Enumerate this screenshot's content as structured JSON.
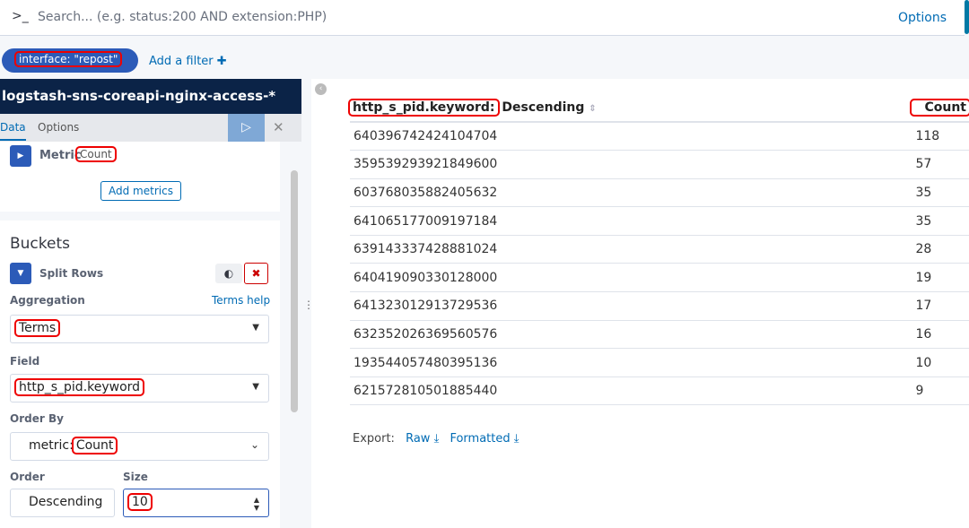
{
  "search": {
    "prompt": ">_",
    "placeholder": "Search... (e.g. status:200 AND extension:PHP)",
    "options": "Options"
  },
  "filters": {
    "pill": "interface: \"repost\"",
    "add": "Add a filter ✚"
  },
  "sidebar": {
    "index": "logstash-sns-coreapi-nginx-access-*",
    "tabs": [
      "Data",
      "Options"
    ],
    "metric": {
      "label": "Metric",
      "value": "Count",
      "add": "Add metrics"
    },
    "buckets": {
      "title": "Buckets",
      "split": "Split Rows",
      "aggregation_label": "Aggregation",
      "help": "Terms help",
      "aggregation": "Terms",
      "field_label": "Field",
      "field": "http_s_pid.keyword",
      "orderby_label": "Order By",
      "orderby_prefix": "metric:",
      "orderby": "Count",
      "order_label": "Order",
      "order": "Descending",
      "size_label": "Size",
      "size": "10"
    }
  },
  "table": {
    "headers": {
      "key": "http_s_pid.keyword:",
      "key_suffix": " Descending",
      "count": "Count"
    },
    "rows": [
      [
        "640396742424104704",
        "118"
      ],
      [
        "359539293921849600",
        "57"
      ],
      [
        "603768035882405632",
        "35"
      ],
      [
        "641065177009197184",
        "35"
      ],
      [
        "639143337428881024",
        "28"
      ],
      [
        "640419090330128000",
        "19"
      ],
      [
        "641323012913729536",
        "17"
      ],
      [
        "632352026369560576",
        "16"
      ],
      [
        "193544057480395136",
        "10"
      ],
      [
        "621572810501885440",
        "9"
      ]
    ]
  },
  "export": {
    "label": "Export:",
    "raw": "Raw",
    "formatted": "Formatted"
  }
}
